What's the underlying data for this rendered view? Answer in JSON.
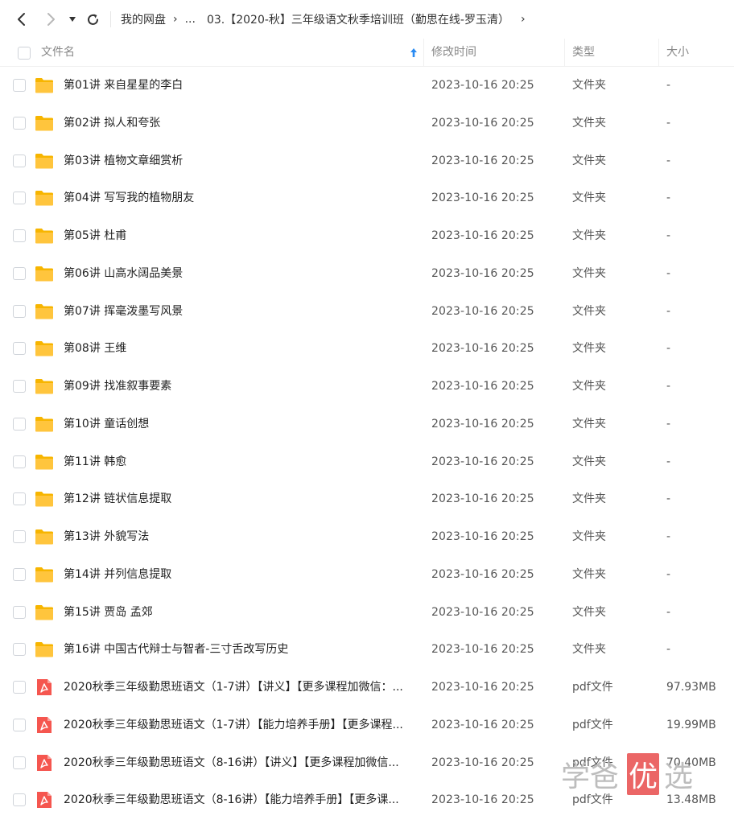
{
  "nav": {
    "breadcrumb": [
      {
        "label": "我的网盘"
      },
      {
        "label": "..."
      },
      {
        "label": "03.【2020-秋】三年级语文秋季培训班（勤思在线-罗玉清）"
      }
    ]
  },
  "columns": {
    "name": "文件名",
    "modified": "修改时间",
    "type": "类型",
    "size": "大小"
  },
  "files": [
    {
      "name": "第01讲 来自星星的李白",
      "modified": "2023-10-16 20:25",
      "type": "文件夹",
      "size": "-",
      "icon": "folder-icon"
    },
    {
      "name": "第02讲 拟人和夸张",
      "modified": "2023-10-16 20:25",
      "type": "文件夹",
      "size": "-",
      "icon": "folder-icon"
    },
    {
      "name": "第03讲 植物文章细赏析",
      "modified": "2023-10-16 20:25",
      "type": "文件夹",
      "size": "-",
      "icon": "folder-icon"
    },
    {
      "name": "第04讲 写写我的植物朋友",
      "modified": "2023-10-16 20:25",
      "type": "文件夹",
      "size": "-",
      "icon": "folder-icon"
    },
    {
      "name": "第05讲 杜甫",
      "modified": "2023-10-16 20:25",
      "type": "文件夹",
      "size": "-",
      "icon": "folder-icon"
    },
    {
      "name": "第06讲 山高水阔品美景",
      "modified": "2023-10-16 20:25",
      "type": "文件夹",
      "size": "-",
      "icon": "folder-icon"
    },
    {
      "name": "第07讲 挥毫泼墨写风景",
      "modified": "2023-10-16 20:25",
      "type": "文件夹",
      "size": "-",
      "icon": "folder-icon"
    },
    {
      "name": "第08讲 王维",
      "modified": "2023-10-16 20:25",
      "type": "文件夹",
      "size": "-",
      "icon": "folder-icon"
    },
    {
      "name": "第09讲 找准叙事要素",
      "modified": "2023-10-16 20:25",
      "type": "文件夹",
      "size": "-",
      "icon": "folder-icon"
    },
    {
      "name": "第10讲 童话创想",
      "modified": "2023-10-16 20:25",
      "type": "文件夹",
      "size": "-",
      "icon": "folder-icon"
    },
    {
      "name": "第11讲 韩愈",
      "modified": "2023-10-16 20:25",
      "type": "文件夹",
      "size": "-",
      "icon": "folder-icon"
    },
    {
      "name": "第12讲 链状信息提取",
      "modified": "2023-10-16 20:25",
      "type": "文件夹",
      "size": "-",
      "icon": "folder-icon"
    },
    {
      "name": "第13讲 外貌写法",
      "modified": "2023-10-16 20:25",
      "type": "文件夹",
      "size": "-",
      "icon": "folder-icon"
    },
    {
      "name": "第14讲 并列信息提取",
      "modified": "2023-10-16 20:25",
      "type": "文件夹",
      "size": "-",
      "icon": "folder-icon"
    },
    {
      "name": "第15讲 贾岛 孟郊",
      "modified": "2023-10-16 20:25",
      "type": "文件夹",
      "size": "-",
      "icon": "folder-icon"
    },
    {
      "name": "第16讲 中国古代辩士与智者-三寸舌改写历史",
      "modified": "2023-10-16 20:25",
      "type": "文件夹",
      "size": "-",
      "icon": "folder-icon"
    },
    {
      "name": "2020秋季三年级勤思班语文（1-7讲）【讲义】【更多课程加微信：...",
      "modified": "2023-10-16 20:25",
      "type": "pdf文件",
      "size": "97.93MB",
      "icon": "pdf-icon"
    },
    {
      "name": "2020秋季三年级勤思班语文（1-7讲）【能力培养手册】【更多课程...",
      "modified": "2023-10-16 20:25",
      "type": "pdf文件",
      "size": "19.99MB",
      "icon": "pdf-icon"
    },
    {
      "name": "2020秋季三年级勤思班语文（8-16讲）【讲义】【更多课程加微信...",
      "modified": "2023-10-16 20:25",
      "type": "pdf文件",
      "size": "70.40MB",
      "icon": "pdf-icon"
    },
    {
      "name": "2020秋季三年级勤思班语文（8-16讲）【能力培养手册】【更多课...",
      "modified": "2023-10-16 20:25",
      "type": "pdf文件",
      "size": "13.48MB",
      "icon": "pdf-icon"
    }
  ],
  "watermark": {
    "part1": "学爸",
    "part2": "优",
    "part3": "选"
  },
  "colors": {
    "folder": "#ffc53d",
    "pdf": "#f5564f",
    "sort_arrow": "#2a8bf2"
  }
}
